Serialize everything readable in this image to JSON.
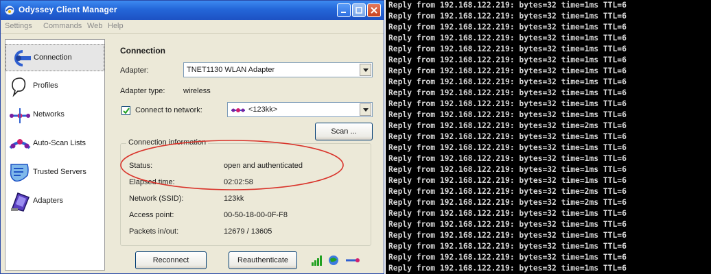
{
  "window": {
    "title": "Odyssey Client Manager",
    "menu": [
      "Settings",
      "Commands",
      "Web",
      "Help"
    ]
  },
  "sidebar": {
    "items": [
      {
        "label": "Connection",
        "icon": "connection-icon"
      },
      {
        "label": "Profiles",
        "icon": "profiles-icon"
      },
      {
        "label": "Networks",
        "icon": "networks-icon"
      },
      {
        "label": "Auto-Scan Lists",
        "icon": "auto-scan-icon"
      },
      {
        "label": "Trusted Servers",
        "icon": "trusted-servers-icon"
      },
      {
        "label": "Adapters",
        "icon": "adapters-icon"
      }
    ]
  },
  "connection": {
    "section_title": "Connection",
    "adapter_label": "Adapter:",
    "adapter_value": "TNET1130 WLAN Adapter",
    "adapter_type_label": "Adapter type:",
    "adapter_type_value": "wireless",
    "connect_label": "Connect to network:",
    "connect_checked": true,
    "network_value": "<123kk>",
    "scan_label": "Scan ..."
  },
  "info": {
    "group_title": "Connection information",
    "rows": [
      {
        "label": "Status:",
        "value": "open and authenticated"
      },
      {
        "label": "Elapsed time:",
        "value": "02:02:58"
      },
      {
        "label": "Network (SSID):",
        "value": "123kk"
      },
      {
        "label": "Access point:",
        "value": "00-50-18-00-0F-F8"
      },
      {
        "label": "Packets in/out:",
        "value": "12679 / 13605"
      }
    ]
  },
  "buttons": {
    "reconnect": "Reconnect",
    "reauthenticate": "Reauthenticate"
  },
  "terminal": {
    "lines": [
      "Reply from 192.168.122.219: bytes=32 time=1ms TTL=6",
      "Reply from 192.168.122.219: bytes=32 time=1ms TTL=6",
      "Reply from 192.168.122.219: bytes=32 time=1ms TTL=6",
      "Reply from 192.168.122.219: bytes=32 time=1ms TTL=6",
      "Reply from 192.168.122.219: bytes=32 time=1ms TTL=6",
      "Reply from 192.168.122.219: bytes=32 time=1ms TTL=6",
      "Reply from 192.168.122.219: bytes=32 time=1ms TTL=6",
      "Reply from 192.168.122.219: bytes=32 time=1ms TTL=6",
      "Reply from 192.168.122.219: bytes=32 time=1ms TTL=6",
      "Reply from 192.168.122.219: bytes=32 time=1ms TTL=6",
      "Reply from 192.168.122.219: bytes=32 time=1ms TTL=6",
      "Reply from 192.168.122.219: bytes=32 time=2ms TTL=6",
      "Reply from 192.168.122.219: bytes=32 time=1ms TTL=6",
      "Reply from 192.168.122.219: bytes=32 time=1ms TTL=6",
      "Reply from 192.168.122.219: bytes=32 time=1ms TTL=6",
      "Reply from 192.168.122.219: bytes=32 time=1ms TTL=6",
      "Reply from 192.168.122.219: bytes=32 time=1ms TTL=6",
      "Reply from 192.168.122.219: bytes=32 time=2ms TTL=6",
      "Reply from 192.168.122.219: bytes=32 time=2ms TTL=6",
      "Reply from 192.168.122.219: bytes=32 time=1ms TTL=6",
      "Reply from 192.168.122.219: bytes=32 time=1ms TTL=6",
      "Reply from 192.168.122.219: bytes=32 time=1ms TTL=6",
      "Reply from 192.168.122.219: bytes=32 time=1ms TTL=6",
      "Reply from 192.168.122.219: bytes=32 time=1ms TTL=6",
      "Reply from 192.168.122.219: bytes=32 time=1ms TTL=6"
    ]
  },
  "colors": {
    "titlebar": "#2466d8",
    "window_bg": "#ece9d8",
    "terminal_bg": "#000000",
    "terminal_text": "#d9d9d9",
    "highlight": "#d9342b"
  }
}
